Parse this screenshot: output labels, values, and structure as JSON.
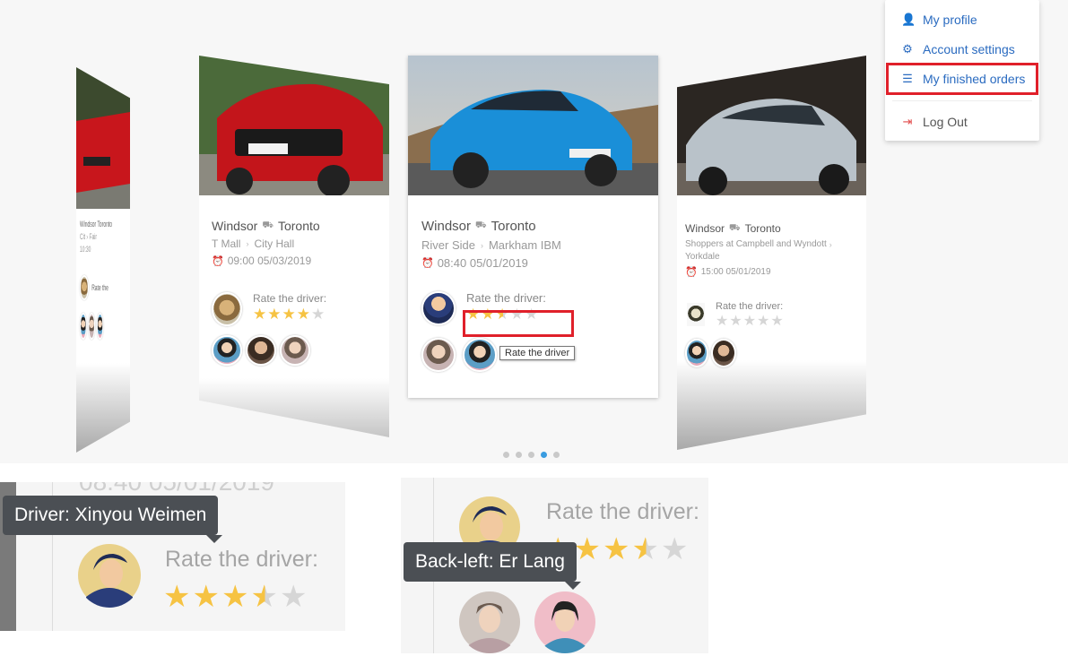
{
  "menu": {
    "items": [
      {
        "label": "My profile",
        "icon": "user-icon"
      },
      {
        "label": "Account settings",
        "icon": "gear-icon"
      },
      {
        "label": "My finished orders",
        "icon": "database-icon"
      },
      {
        "label": "Log Out",
        "icon": "logout-icon"
      }
    ]
  },
  "cards": {
    "far_left": {
      "route_from": "Windsor",
      "route_to": "Toronto",
      "stop_from": "Cit",
      "stop_to": "Fair",
      "time": "10:30",
      "rate_label": "Rate the"
    },
    "left": {
      "route_from": "Windsor",
      "route_to": "Toronto",
      "stop_from": "T Mall",
      "stop_to": "City Hall",
      "time": "09:00 05/03/2019",
      "rate_label": "Rate the driver:",
      "rating": 4
    },
    "center": {
      "route_from": "Windsor",
      "route_to": "Toronto",
      "stop_from": "River Side",
      "stop_to": "Markham IBM",
      "time": "08:40 05/01/2019",
      "rate_label": "Rate the driver:",
      "rating": 2.5,
      "tooltip": "Rate the driver"
    },
    "right": {
      "route_from": "Windsor",
      "route_to": "Toronto",
      "stop_from": "Shoppers at Campbell and Wyndott",
      "stop_to": "Yorkdale",
      "time": "15:00 05/01/2019",
      "rate_label": "Rate the driver:",
      "rating": 0
    }
  },
  "carousel": {
    "total_slides": 5,
    "active_slide": 3
  },
  "zoom_left": {
    "tooltip": "Driver: Xinyou Weimen",
    "rate_label": "Rate the driver:",
    "ghost_text": "08:40 05/01/2019",
    "rating": 3.5
  },
  "zoom_right": {
    "tooltip": "Back-left: Er Lang",
    "rate_label": "Rate the driver:",
    "rating": 3.5
  },
  "colors": {
    "accent": "#3a9ce0",
    "star": "#f6c343",
    "highlight": "#e0202a",
    "tooltip_bg": "#4b4f54"
  }
}
